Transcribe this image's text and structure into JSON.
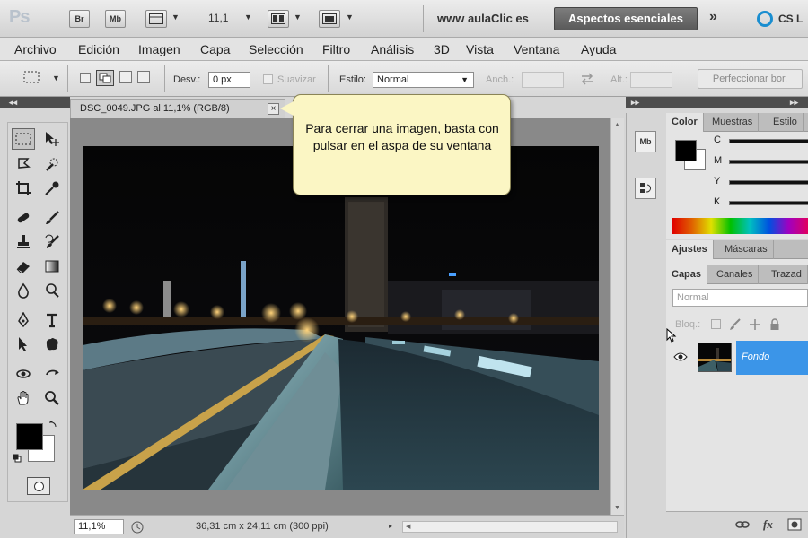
{
  "app": {
    "logo": "Ps",
    "bridge_label": "Br",
    "minibridge_label": "Mb",
    "zoom_level": "11,1",
    "site": "www aulaClic es",
    "workspace": "Aspectos esenciales",
    "more": "»",
    "cslive": "CS L"
  },
  "menu": [
    "Archivo",
    "Edición",
    "Imagen",
    "Capa",
    "Selección",
    "Filtro",
    "Análisis",
    "3D",
    "Vista",
    "Ventana",
    "Ayuda"
  ],
  "options": {
    "feather_label": "Desv.:",
    "feather_value": "0 px",
    "antialias_label": "Suavizar",
    "style_label": "Estilo:",
    "style_value": "Normal",
    "width_label": "Anch.:",
    "height_label": "Alt.:",
    "refine_label": "Perfeccionar bor."
  },
  "document": {
    "title": "DSC_0049.JPG al 11,1% (RGB/8)",
    "close_glyph": "×",
    "zoom": "11,1%",
    "info": "36,31 cm x 24,11 cm (300 ppi)"
  },
  "dock": {
    "mini_bridge": "Mb"
  },
  "panels": {
    "color_tabs": [
      "Color",
      "Muestras",
      "Estilo"
    ],
    "channels": [
      "C",
      "M",
      "Y",
      "K"
    ],
    "adjust_tabs": [
      "Ajustes",
      "Máscaras"
    ],
    "layers_tabs": [
      "Capas",
      "Canales",
      "Trazad"
    ],
    "blend_mode": "Normal",
    "lock_label": "Bloq.:",
    "layer_name": "Fondo"
  },
  "tooltip": "Para cerrar una imagen, basta con pulsar en el aspa de su ventana",
  "colors": {
    "accent": "#3b95e8",
    "workspace_button": "#666666",
    "callout": "#fbf6c4",
    "foreground": "#000000",
    "background": "#ffffff"
  }
}
